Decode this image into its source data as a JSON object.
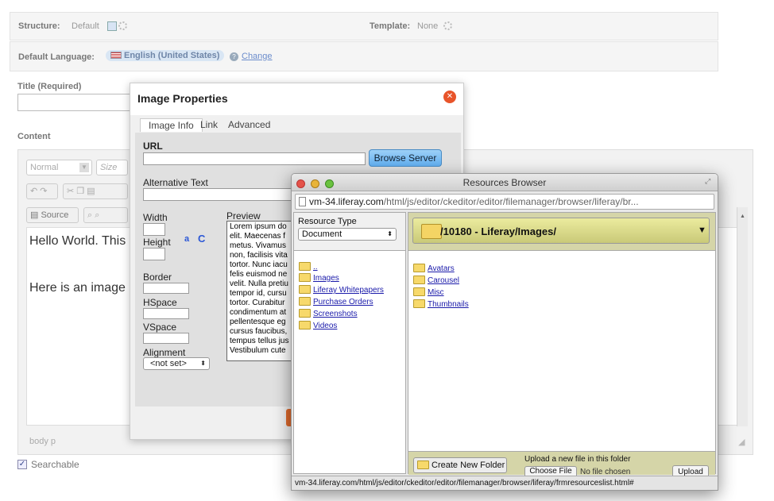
{
  "structure": {
    "label": "Structure:",
    "value": "Default"
  },
  "template": {
    "label": "Template:",
    "value": "None"
  },
  "language": {
    "label": "Default Language:",
    "value": "English (United States)",
    "change": "Change"
  },
  "title_label": "Title (Required)",
  "content_label": "Content",
  "editor": {
    "format": "Normal",
    "size": "Size",
    "source": "Source",
    "line1": "Hello World. This",
    "line2": "Here is an image",
    "path": "body  p"
  },
  "searchable_label": "Searchable",
  "image_dialog": {
    "title": "Image Properties",
    "tabs": [
      "Image Info",
      "Link",
      "Advanced"
    ],
    "url_label": "URL",
    "browse_button": "Browse Server",
    "alt_label": "Alternative Text",
    "width_label": "Width",
    "height_label": "Height",
    "lock_glyph": "a",
    "reset_glyph": "C",
    "border_label": "Border",
    "hspace_label": "HSpace",
    "vspace_label": "VSpace",
    "alignment_label": "Alignment",
    "alignment_value": "<not set>",
    "preview_label": "Preview",
    "preview_lines": [
      "Lorem ipsum do",
      "elit. Maecenas f",
      "metus. Vivamus",
      "non, facilisis vita",
      "tortor. Nunc iacu",
      "felis euismod ne",
      "velit. Nulla pretiu",
      "tempor id, cursu",
      "tortor. Curabitur",
      "condimentum at",
      "pellentesque eg",
      "cursus faucibus,",
      "tempus tellus jus",
      "Vestibulum cute"
    ]
  },
  "browser": {
    "title": "Resources Browser",
    "address_host": "vm-34.liferay.com",
    "address_path": "/html/js/editor/ckeditor/editor/filemanager/browser/liferay/br...",
    "resource_type_label": "Resource Type",
    "resource_type_value": "Document",
    "current_path": "/10180 - Liferay/Images/",
    "tree": [
      "..",
      "Images",
      "Liferay Whitepapers",
      "Purchase Orders",
      "Screenshots",
      "Videos"
    ],
    "folders": [
      "Avatars",
      "Carousel",
      "Misc",
      "Thumbnails"
    ],
    "create_folder_button": "Create New Folder",
    "upload_label": "Upload a new file in this folder",
    "choose_file": "Choose File",
    "no_file": "No file chosen",
    "upload_button": "Upload",
    "status_url": "vm-34.liferay.com/html/js/editor/ckeditor/editor/filemanager/browser/liferay/frmresourceslist.html#"
  }
}
